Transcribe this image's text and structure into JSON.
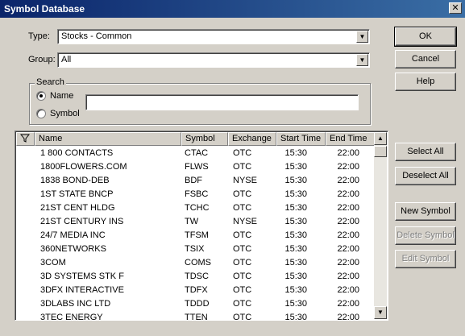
{
  "window": {
    "title": "Symbol Database",
    "close_glyph": "✕"
  },
  "form": {
    "type_label": "Type:",
    "type_value": "Stocks - Common",
    "group_label": "Group:",
    "group_value": "All",
    "search_legend": "Search",
    "name_option": "Name",
    "symbol_option": "Symbol",
    "selected_option": "name",
    "search_value": ""
  },
  "buttons": {
    "ok": "OK",
    "cancel": "Cancel",
    "help": "Help",
    "select_all": "Select All",
    "deselect_all": "Deselect All",
    "new_symbol": "New Symbol",
    "delete_symbol": "Delete Symbol",
    "edit_symbol": "Edit Symbol"
  },
  "table": {
    "filter_icon": "filter-icon",
    "columns": [
      "Name",
      "Symbol",
      "Exchange",
      "Start Time",
      "End Time"
    ],
    "rows": [
      [
        "1 800 CONTACTS",
        "CTAC",
        "OTC",
        "15:30",
        "22:00"
      ],
      [
        "1800FLOWERS.COM",
        "FLWS",
        "OTC",
        "15:30",
        "22:00"
      ],
      [
        "1838 BOND-DEB",
        "BDF",
        "NYSE",
        "15:30",
        "22:00"
      ],
      [
        "1ST STATE BNCP",
        "FSBC",
        "OTC",
        "15:30",
        "22:00"
      ],
      [
        "21ST CENT HLDG",
        "TCHC",
        "OTC",
        "15:30",
        "22:00"
      ],
      [
        "21ST CENTURY INS",
        "TW",
        "NYSE",
        "15:30",
        "22:00"
      ],
      [
        "24/7 MEDIA INC",
        "TFSM",
        "OTC",
        "15:30",
        "22:00"
      ],
      [
        "360NETWORKS",
        "TSIX",
        "OTC",
        "15:30",
        "22:00"
      ],
      [
        "3COM",
        "COMS",
        "OTC",
        "15:30",
        "22:00"
      ],
      [
        "3D SYSTEMS STK F",
        "TDSC",
        "OTC",
        "15:30",
        "22:00"
      ],
      [
        "3DFX INTERACTIVE",
        "TDFX",
        "OTC",
        "15:30",
        "22:00"
      ],
      [
        "3DLABS INC LTD",
        "TDDD",
        "OTC",
        "15:30",
        "22:00"
      ],
      [
        "3TEC ENERGY",
        "TTEN",
        "OTC",
        "15:30",
        "22:00"
      ]
    ]
  }
}
